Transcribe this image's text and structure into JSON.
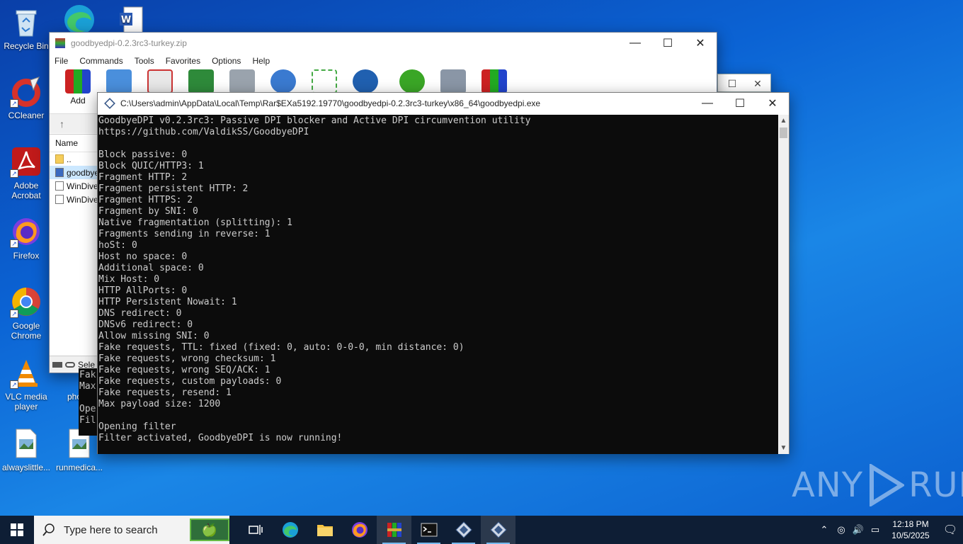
{
  "desktop": {
    "icons": [
      {
        "label": "Recycle Bin"
      },
      {
        "label": "CCleaner"
      },
      {
        "label": "Adobe Acrobat"
      },
      {
        "label": "Firefox"
      },
      {
        "label": "Google Chrome"
      },
      {
        "label": "VLC media player"
      },
      {
        "label": "alwayslittle..."
      },
      {
        "label": "photo"
      },
      {
        "label": "runmedica..."
      }
    ]
  },
  "winrar": {
    "title": "goodbyedpi-0.2.3rc3-turkey.zip",
    "menu": [
      "File",
      "Commands",
      "Tools",
      "Favorites",
      "Options",
      "Help"
    ],
    "toolbar_add": "Add",
    "up_arrow": "↑",
    "column_name": "Name",
    "files": [
      "..",
      "goodbye",
      "WinDive",
      "WinDive"
    ],
    "status": "Sele"
  },
  "peek_lines": [
    "Fak",
    "Max",
    "",
    "Ope",
    "Fil"
  ],
  "console": {
    "title": "C:\\Users\\admin\\AppData\\Local\\Temp\\Rar$EXa5192.19770\\goodbyedpi-0.2.3rc3-turkey\\x86_64\\goodbyedpi.exe",
    "lines": [
      "GoodbyeDPI v0.2.3rc3: Passive DPI blocker and Active DPI circumvention utility",
      "https://github.com/ValdikSS/GoodbyeDPI",
      "",
      "Block passive: 0",
      "Block QUIC/HTTP3: 1",
      "Fragment HTTP: 2",
      "Fragment persistent HTTP: 2",
      "Fragment HTTPS: 2",
      "Fragment by SNI: 0",
      "Native fragmentation (splitting): 1",
      "Fragments sending in reverse: 1",
      "hoSt: 0",
      "Host no space: 0",
      "Additional space: 0",
      "Mix Host: 0",
      "HTTP AllPorts: 0",
      "HTTP Persistent Nowait: 1",
      "DNS redirect: 0",
      "DNSv6 redirect: 0",
      "Allow missing SNI: 0",
      "Fake requests, TTL: fixed (fixed: 0, auto: 0-0-0, min distance: 0)",
      "Fake requests, wrong checksum: 1",
      "Fake requests, wrong SEQ/ACK: 1",
      "Fake requests, custom payloads: 0",
      "Fake requests, resend: 1",
      "Max payload size: 1200",
      "",
      "Opening filter",
      "Filter activated, GoodbyeDPI is now running!"
    ]
  },
  "watermark": {
    "left": "ANY",
    "right": "RUN"
  },
  "taskbar": {
    "search_placeholder": "Type here to search",
    "time": "12:18 PM",
    "date": "10/5/2025"
  },
  "colors": {
    "console_bg": "#0c0c0c",
    "console_fg": "#cccccc",
    "taskbar": "#0e1e35"
  }
}
